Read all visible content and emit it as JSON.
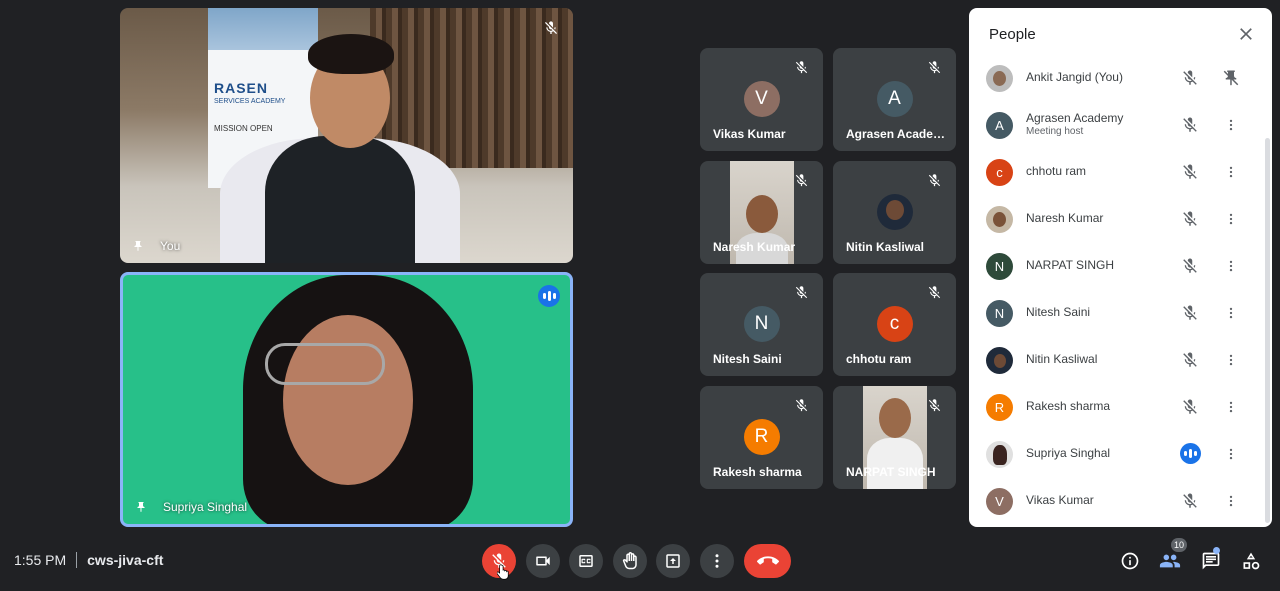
{
  "meeting": {
    "time": "1:55 PM",
    "code": "cws-jiva-cft"
  },
  "main_tiles": {
    "you": {
      "label": "You"
    },
    "presenter": {
      "label": "Supriya Singhal"
    }
  },
  "banner_text": {
    "line1": "RASEN",
    "line2": "SERVICES ACADEMY",
    "line3": "MISSION OPEN"
  },
  "grid_tiles": [
    {
      "name": "Vikas Kumar",
      "initial": "V",
      "color": "#8d6e63"
    },
    {
      "name": "Agrasen Academy",
      "initial": "A",
      "color": "#455a64"
    },
    {
      "name": "Naresh Kumar",
      "initial": "",
      "color": "#c9c1b6"
    },
    {
      "name": "Nitin Kasliwal",
      "initial": "",
      "color": "#1f2a3a"
    },
    {
      "name": "Nitesh Saini",
      "initial": "N",
      "color": "#455a64"
    },
    {
      "name": "chhotu ram",
      "initial": "c",
      "color": "#d84315"
    },
    {
      "name": "Rakesh sharma",
      "initial": "R",
      "color": "#f57c00"
    },
    {
      "name": "NARPAT SINGH",
      "initial": "",
      "color": "#c9c1b6"
    }
  ],
  "people_panel": {
    "title": "People",
    "participants": [
      {
        "name": "Ankit Jangid (You)",
        "initial": "",
        "color": "#9e9e9e",
        "subtitle": ""
      },
      {
        "name": "Agrasen Academy",
        "initial": "A",
        "color": "#455a64",
        "subtitle": "Meeting host"
      },
      {
        "name": "chhotu ram",
        "initial": "c",
        "color": "#d84315",
        "subtitle": ""
      },
      {
        "name": "Naresh Kumar",
        "initial": "",
        "color": "#a1887f",
        "subtitle": ""
      },
      {
        "name": "NARPAT SINGH",
        "initial": "N",
        "color": "#2e4a3a",
        "subtitle": ""
      },
      {
        "name": "Nitesh Saini",
        "initial": "N",
        "color": "#455a64",
        "subtitle": ""
      },
      {
        "name": "Nitin Kasliwal",
        "initial": "",
        "color": "#1f2a3a",
        "subtitle": ""
      },
      {
        "name": "Rakesh sharma",
        "initial": "R",
        "color": "#f57c00",
        "subtitle": ""
      },
      {
        "name": "Supriya Singhal",
        "initial": "",
        "color": "#6d4c41",
        "subtitle": ""
      },
      {
        "name": "Vikas Kumar",
        "initial": "V",
        "color": "#8d6e63",
        "subtitle": ""
      }
    ]
  },
  "toolbar": {
    "participant_count": "10",
    "icons": [
      "mic-off-icon",
      "camera-icon",
      "captions-icon",
      "raise-hand-icon",
      "present-screen-icon",
      "more-options-icon",
      "end-call-icon"
    ],
    "right_icons": [
      "info-icon",
      "people-icon",
      "chat-icon",
      "activities-icon"
    ]
  },
  "colors": {
    "background": "#202124",
    "tile": "#3c4043",
    "accent": "#1a73e8",
    "danger": "#ea4335"
  }
}
